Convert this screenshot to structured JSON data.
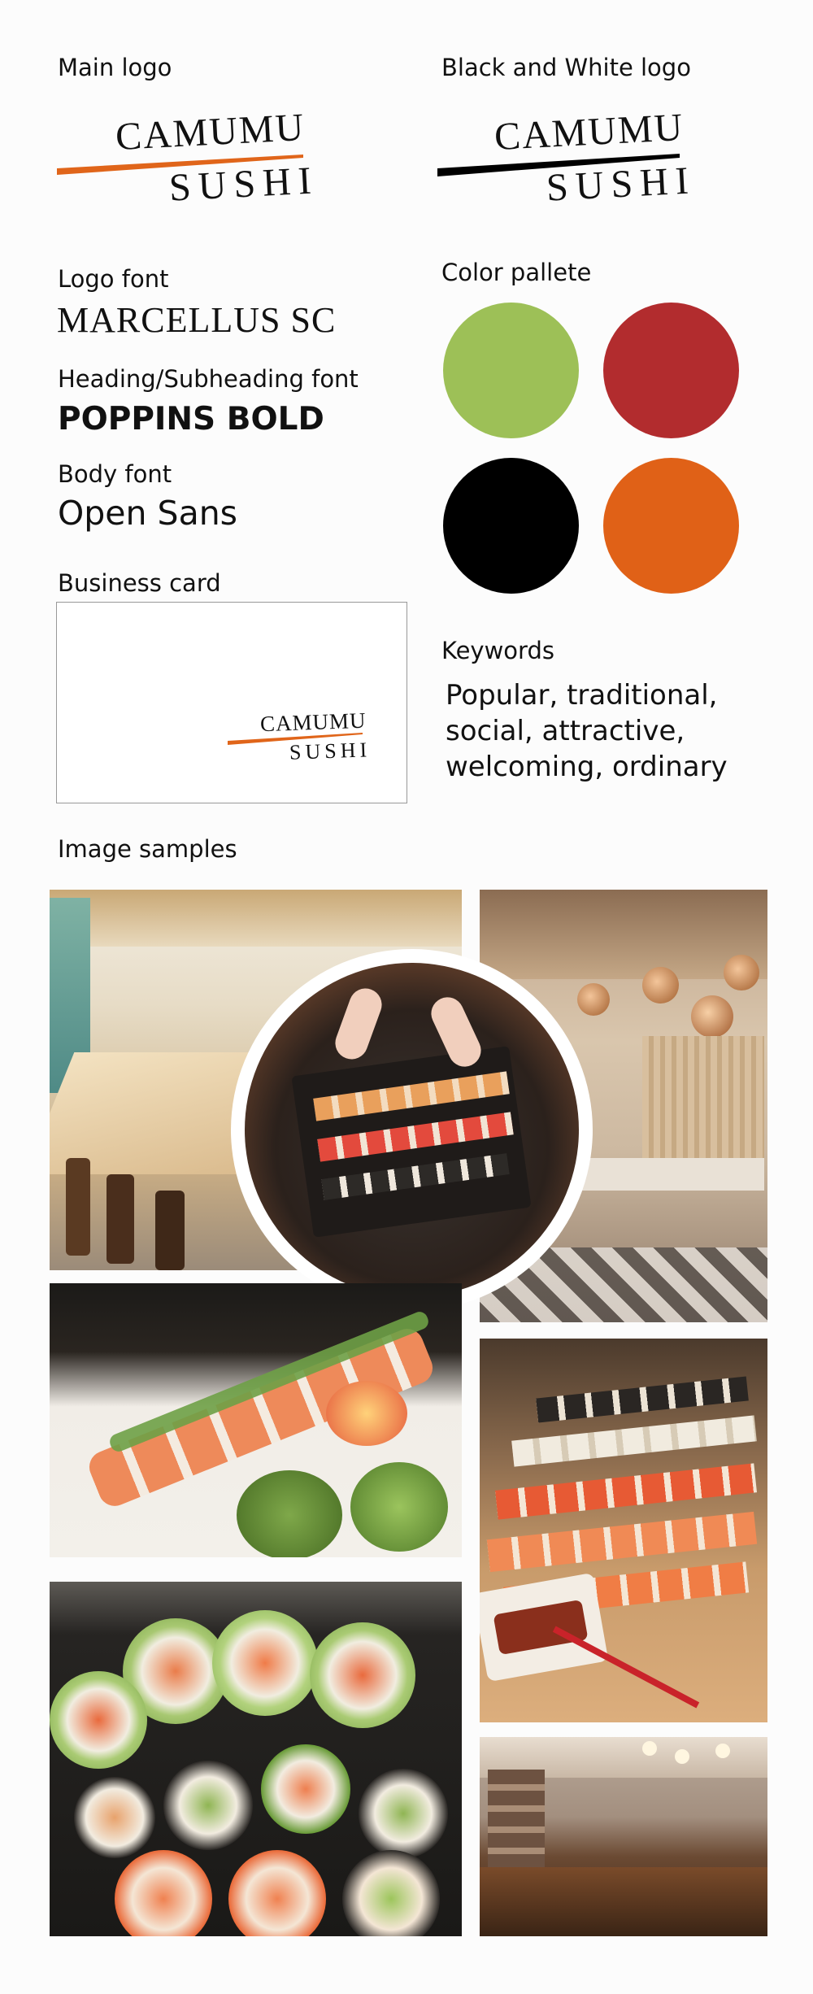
{
  "labels": {
    "main_logo": "Main logo",
    "bw_logo": "Black and White logo",
    "logo_font": "Logo font",
    "heading_font": "Heading/Subheading font",
    "body_font": "Body font",
    "business_card": "Business card",
    "color_palette": "Color pallete",
    "keywords": "Keywords",
    "image_samples": "Image samples"
  },
  "logo": {
    "line1": "CAMUMU",
    "line2": "SUSHI"
  },
  "fonts": {
    "logo_font_name": "MARCELLUS SC",
    "heading_font_name": "POPPINS BOLD",
    "body_font_name": "Open Sans"
  },
  "keywords_text": [
    "Popular, traditional,",
    "social, attractive,",
    "welcoming, ordinary"
  ],
  "palette": [
    "#9dc057",
    "#b22c2e",
    "#000000",
    "#e06117"
  ],
  "accent_color": "#e0651a"
}
